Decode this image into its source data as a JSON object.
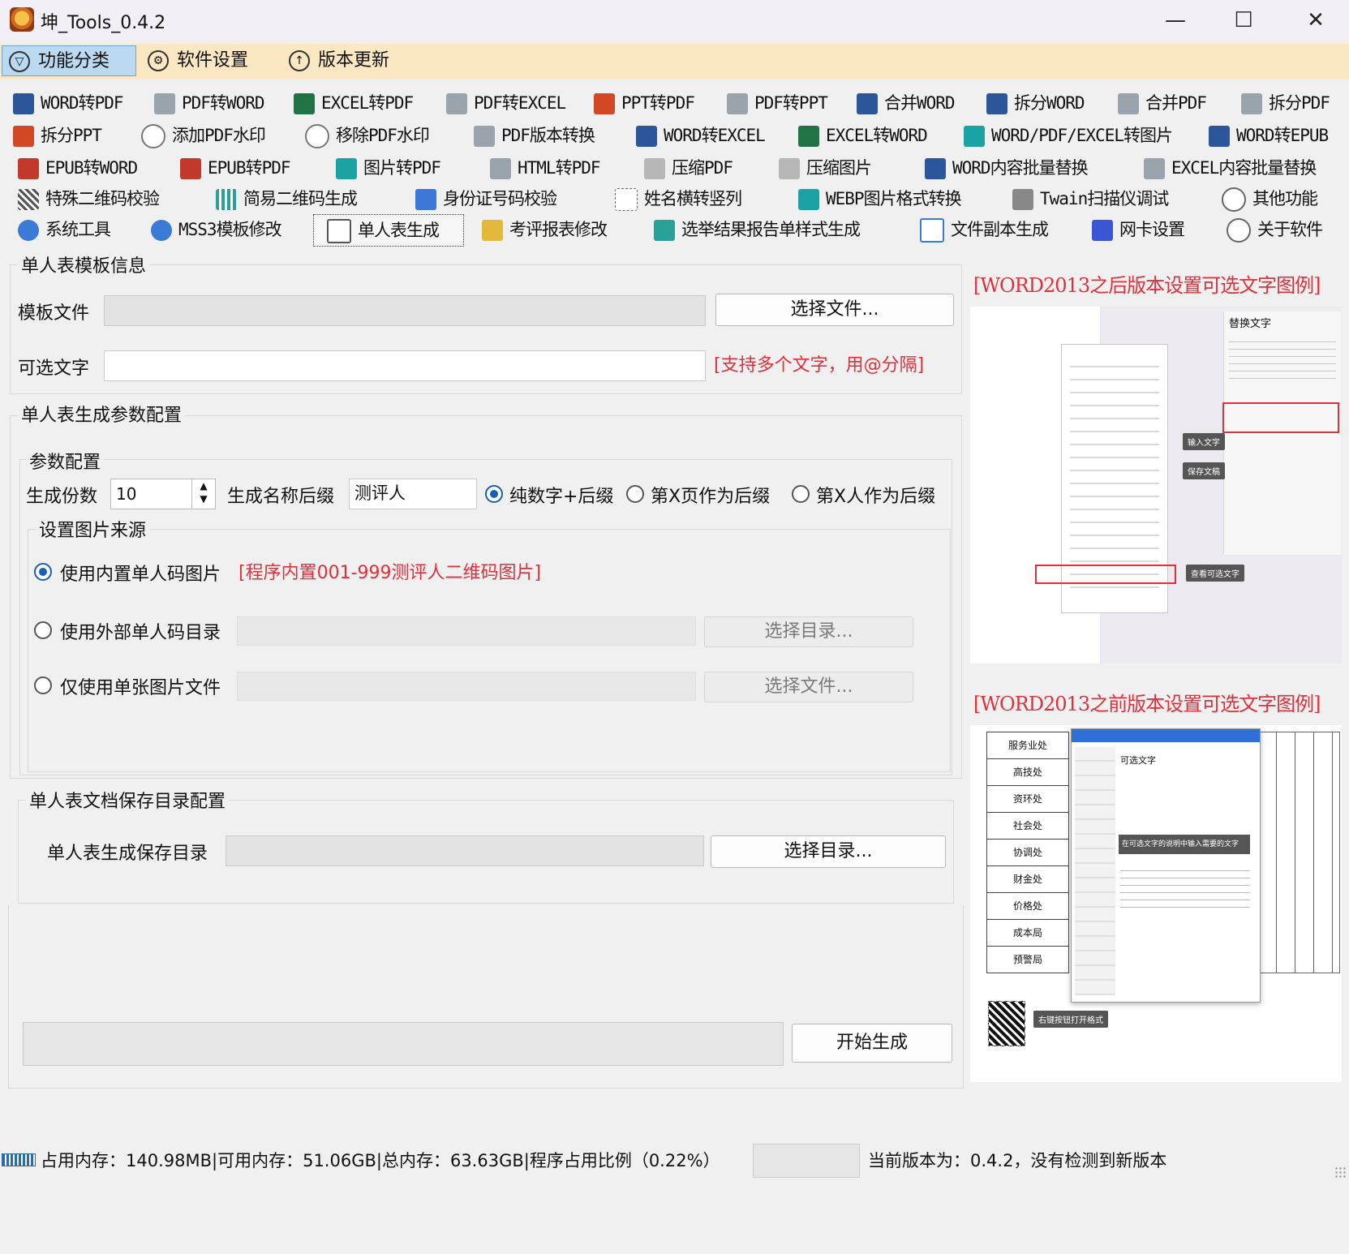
{
  "window": {
    "title": "坤_Tools_0.4.2",
    "controls": {
      "minimize": "—",
      "maximize": "☐",
      "close": "✕"
    }
  },
  "menu": [
    {
      "label": "功能分类",
      "icon": "funnel-icon",
      "active": true
    },
    {
      "label": "软件设置",
      "icon": "gear-icon"
    },
    {
      "label": "版本更新",
      "icon": "arrow-up-icon"
    }
  ],
  "tools": {
    "row1": [
      "WORD转PDF",
      "PDF转WORD",
      "EXCEL转PDF",
      "PDF转EXCEL",
      "PPT转PDF",
      "PDF转PPT",
      "合并WORD",
      "拆分WORD",
      "合并PDF",
      "拆分PDF"
    ],
    "row2": [
      "拆分PPT",
      "添加PDF水印",
      "移除PDF水印",
      "PDF版本转换",
      "WORD转EXCEL",
      "EXCEL转WORD",
      "WORD/PDF/EXCEL转图片",
      "WORD转EPUB"
    ],
    "row3": [
      "EPUB转WORD",
      "EPUB转PDF",
      "图片转PDF",
      "HTML转PDF",
      "压缩PDF",
      "压缩图片",
      "WORD内容批量替换",
      "EXCEL内容批量替换"
    ],
    "row4": [
      "特殊二维码校验",
      "简易二维码生成",
      "身份证号码校验",
      "姓名横转竖列",
      "WEBP图片格式转换",
      "Twain扫描仪调试",
      "其他功能"
    ],
    "row5": [
      "系统工具",
      "MSS3模板修改",
      "单人表生成",
      "考评报表修改",
      "选举结果报告单样式生成",
      "文件副本生成",
      "网卡设置",
      "关于软件"
    ]
  },
  "template_group": {
    "title": "单人表模板信息",
    "template_file_label": "模板文件",
    "template_file_value": "",
    "select_file_button": "选择文件...",
    "optional_text_label": "可选文字",
    "optional_text_value": "",
    "hint": "[支持多个文字，用@分隔]"
  },
  "params_group": {
    "title": "单人表生成参数配置",
    "sub_title": "参数配置",
    "copies_label": "生成份数",
    "copies_value": "10",
    "suffix_label": "生成名称后缀",
    "suffix_value": "测评人",
    "suffix_options": [
      "纯数字+后缀",
      "第X页作为后缀",
      "第X人作为后缀"
    ],
    "suffix_selected": 0,
    "image_source_title": "设置图片来源",
    "image_options": {
      "builtin": "使用内置单人码图片",
      "builtin_hint": "[程序内置001-999测评人二维码图片]",
      "external_dir": "使用外部单人码目录",
      "single_file": "仅使用单张图片文件"
    },
    "select_dir_button": "选择目录...",
    "select_file_button": "选择文件..."
  },
  "save_group": {
    "title": "单人表文档保存目录配置",
    "save_dir_label": "单人表生成保存目录",
    "save_dir_value": "",
    "select_dir_button": "选择目录..."
  },
  "actions": {
    "progress": 0,
    "start_button": "开始生成"
  },
  "examples": {
    "after_2013": "[WORD2013之后版本设置可选文字图例]",
    "before_2013": "[WORD2013之前版本设置可选文字图例]",
    "after_panel_title": "替换文字",
    "after_callouts": [
      "输入文字",
      "保存文稿",
      "查看可选文字"
    ],
    "before_dialog_heading": "可选文字",
    "before_callouts": [
      "在可选文字的说明中输入需要的文字",
      "右键按钮打开格式"
    ],
    "before_table_rows": [
      "服务业处",
      "高技处",
      "资环处",
      "社会处",
      "协调处",
      "财金处",
      "价格处",
      "成本局",
      "预警局"
    ]
  },
  "status": {
    "memory_text": "占用内存：140.98MB|可用内存：51.06GB|总内存：63.63GB|程序占用比例（0.22%）",
    "version_text": "当前版本为：0.4.2，没有检测到新版本"
  }
}
